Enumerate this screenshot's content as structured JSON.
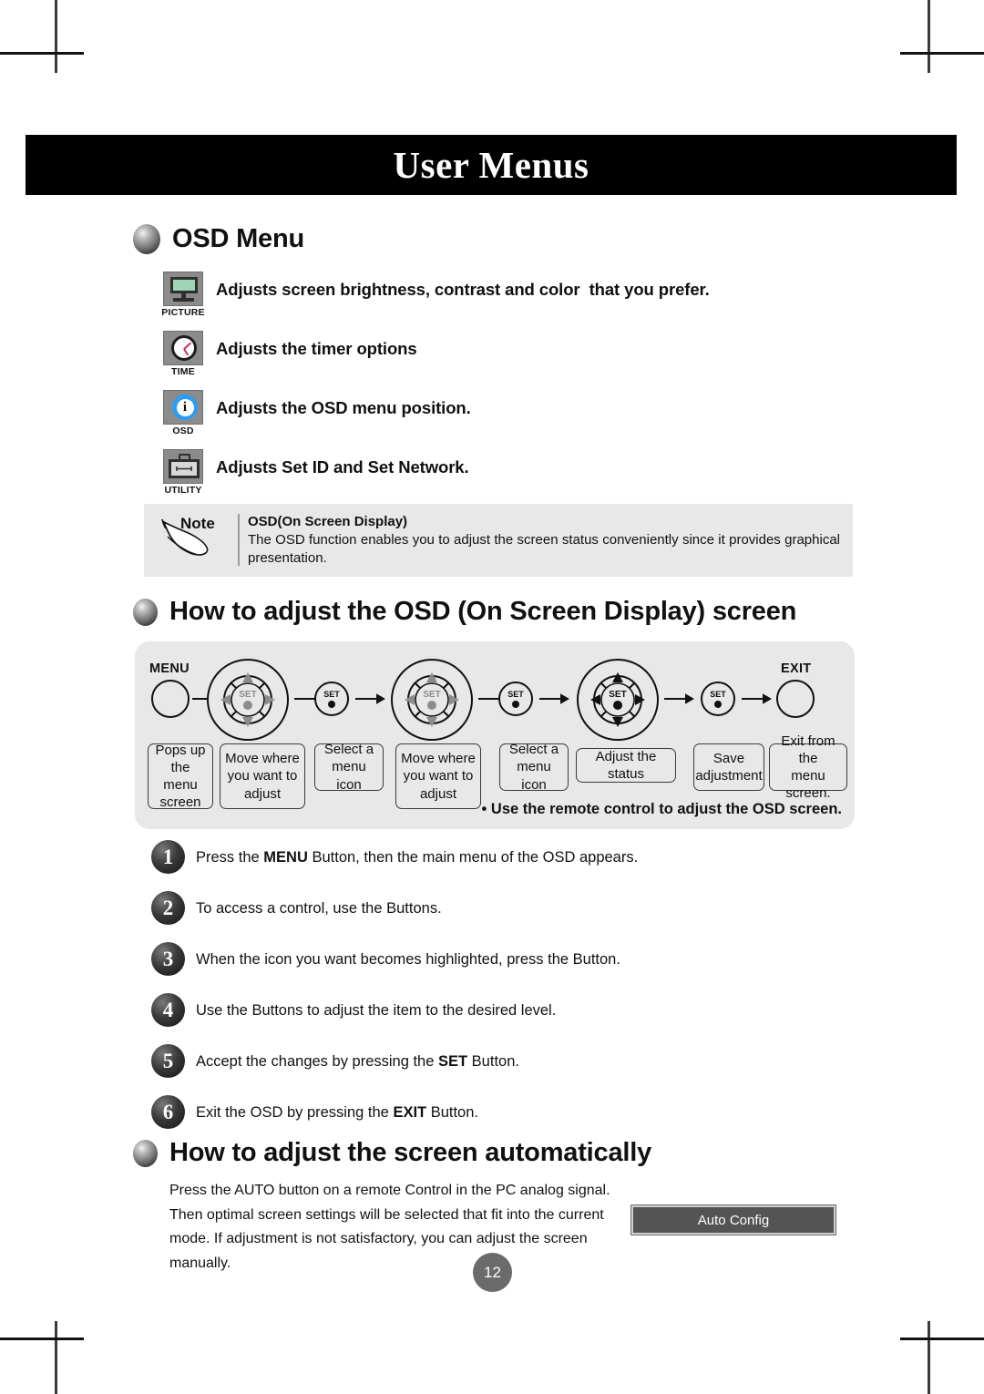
{
  "banner": {
    "title": "User Menus"
  },
  "osd_section": {
    "heading": "OSD Menu",
    "items": [
      {
        "icon": "picture-icon",
        "caption": "PICTURE",
        "text": "Adjusts screen brightness, contrast and color  that you prefer."
      },
      {
        "icon": "time-clock-icon",
        "caption": "TIME",
        "text": "Adjusts the timer options"
      },
      {
        "icon": "osd-info-icon",
        "caption": "OSD",
        "text": "Adjusts the OSD menu position."
      },
      {
        "icon": "utility-toolbox-icon",
        "caption": "UTILITY",
        "text": "Adjusts Set ID and Set Network."
      }
    ]
  },
  "note": {
    "label": "Note",
    "title": "OSD(On Screen Display)",
    "text": "The OSD function enables you to adjust the screen status conveniently since it provides graphical presentation."
  },
  "howto_osd": {
    "heading": "How to adjust the OSD (On Screen Display) screen",
    "buttons": {
      "menu_label": "MENU",
      "exit_label": "EXIT",
      "set_label": "SET"
    },
    "caption_boxes": [
      "Pops up\nthe menu\nscreen",
      "Move where\nyou want to\nadjust",
      "Select a\nmenu icon",
      "Move where\nyou want to\nadjust",
      "Select a\nmenu icon",
      "Adjust the status",
      "Save\nadjustment",
      "Exit from the\nmenu screen."
    ],
    "footnote": "• Use the remote control to adjust the OSD screen."
  },
  "steps": [
    {
      "num": "1",
      "pre": "Press the ",
      "bold": "MENU",
      "post": " Button, then the main menu of the OSD appears."
    },
    {
      "num": "2",
      "pre": "To access a control, use the Buttons.",
      "bold": "",
      "post": ""
    },
    {
      "num": "3",
      "pre": "When the icon you want becomes highlighted, press the Button.",
      "bold": "",
      "post": ""
    },
    {
      "num": "4",
      "pre": "Use the Buttons to adjust the item to the desired level.",
      "bold": "",
      "post": ""
    },
    {
      "num": "5",
      "pre": "Accept the changes by pressing the ",
      "bold": "SET",
      "post": " Button."
    },
    {
      "num": "6",
      "pre": "Exit the OSD by pressing the ",
      "bold": "EXIT",
      "post": " Button."
    }
  ],
  "auto_section": {
    "heading": "How to adjust the screen automatically",
    "body": "Press the AUTO button on a remote Control in the PC analog signal. Then optimal screen settings will be selected that fit into the current mode. If adjustment is not satisfactory, you can adjust the screen manually.",
    "auto_config_label": "Auto Config"
  },
  "page_number": "12",
  "colors": {
    "banner_bg": "#000000",
    "panel_bg": "#e8e8e8",
    "icon_bg": "#8b8b8b",
    "picture_screen": "#9fd3b6",
    "osd_blue": "#2a9df4",
    "clock_hand": "#c0305c",
    "auto_config_bg": "#545454",
    "page_badge": "#6b6b6b"
  }
}
